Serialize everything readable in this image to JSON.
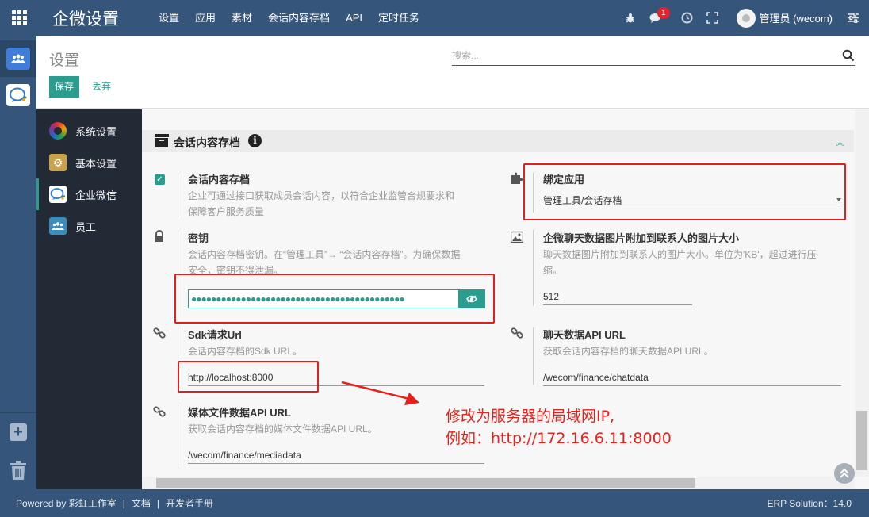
{
  "app": {
    "title": "企微设置",
    "menu": [
      "设置",
      "应用",
      "素材",
      "会话内容存档",
      "API",
      "定时任务"
    ],
    "notification_count": "1",
    "user_name": "管理员 (wecom)"
  },
  "control_panel": {
    "title": "设置",
    "search_placeholder": "搜索...",
    "save_label": "保存",
    "discard_label": "丢弃"
  },
  "settings_nav": {
    "items": [
      {
        "label": "系统设置",
        "icon": "color-ring-icon"
      },
      {
        "label": "基本设置",
        "icon": "gear-icon"
      },
      {
        "label": "企业微信",
        "icon": "wecom-icon",
        "active": true
      },
      {
        "label": "员工",
        "icon": "employees-icon"
      }
    ]
  },
  "section": {
    "title": "会话内容存档"
  },
  "fields": {
    "archive": {
      "label": "会话内容存档",
      "desc_1": "企业可通过接口获取成员会话内容，以符合企业监管合规要求和",
      "desc_2": "保障客户服务质量",
      "checked": true
    },
    "bind_app": {
      "label": "绑定应用",
      "value": "管理工具/会话存档"
    },
    "secret": {
      "label": "密钥",
      "desc_1": "会话内容存档密钥。在“管理工具”→ “会话内容存档”。为确保数据",
      "desc_2": "安全，密钥不得泄漏。",
      "value": "●●●●●●●●●●●●●●●●●●●●●●●●●●●●●●●●●●●●●●●●●●●"
    },
    "image_size": {
      "label": "企微聊天数据图片附加到联系人的图片大小",
      "desc_1": "聊天数据图片附加到联系人的图片大小。单位为'KB'，超过进行压",
      "desc_2": "缩。",
      "value": "512"
    },
    "sdk_url": {
      "label": "Sdk请求Url",
      "desc": "会话内容存档的Sdk URL。",
      "value": "http://localhost:8000"
    },
    "chat_api": {
      "label": "聊天数据API URL",
      "desc": "获取会话内容存档的聊天数据API URL。",
      "value": "/wecom/finance/chatdata"
    },
    "media_api": {
      "label": "媒体文件数据API URL",
      "desc": "获取会话内容存档的媒体文件数据API URL。",
      "value": "/wecom/finance/mediadata"
    }
  },
  "annotation": {
    "line1": "修改为服务器的局域网IP,",
    "line2": "例如：http://172.16.6.11:8000",
    "color": "#e8201c"
  },
  "footer": {
    "powered": "Powered by 彩虹工作室",
    "docs": "文档",
    "dev_manual": "开发者手册",
    "version": "ERP Solution：14.0"
  },
  "colors": {
    "navbar": "#35557a",
    "accent": "#2b9d8f",
    "sidebar": "#222a36"
  }
}
